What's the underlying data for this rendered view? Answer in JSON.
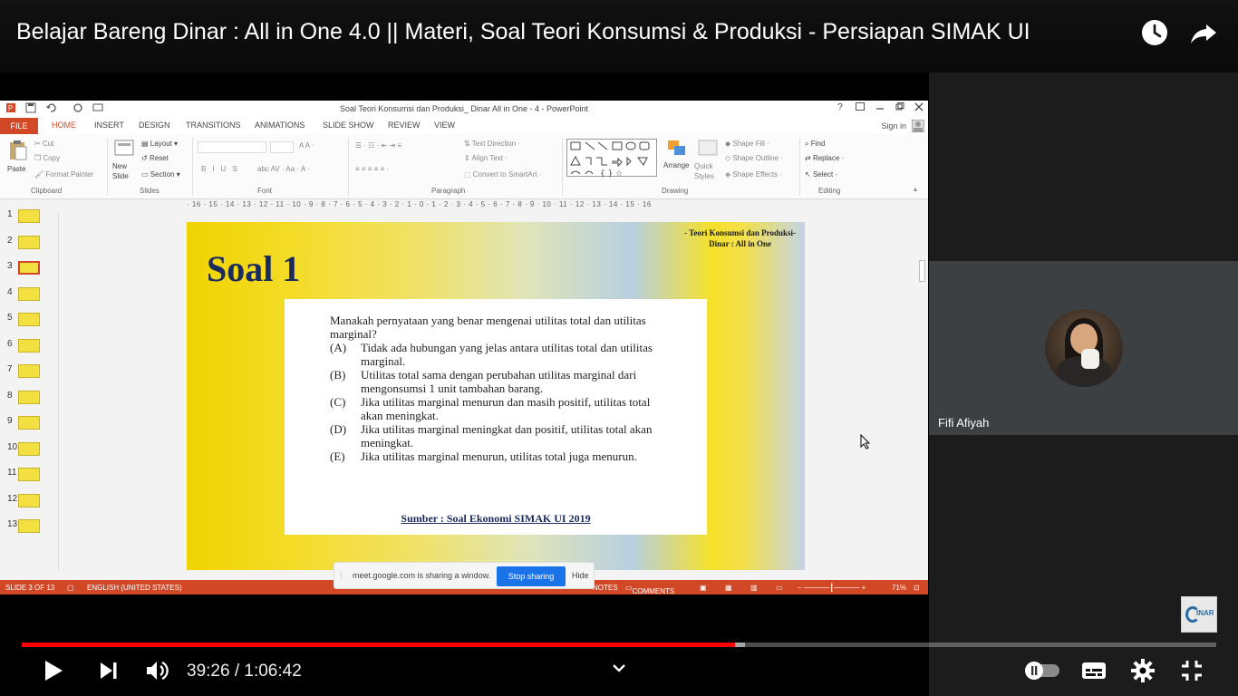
{
  "video": {
    "title": "Belajar Bareng Dinar : All in One 4.0 || Materi, Soal Teori Konsumsi & Produksi - Persiapan SIMAK UI",
    "current_time": "39:26",
    "separator": " / ",
    "duration": "1:06:42",
    "progress": 0.5974,
    "buffered": 0.6052,
    "progress_color": "#ff0000"
  },
  "powerpoint": {
    "window_title": "Soal Teori Konsumsi dan Produksi_ Dinar All in One - 4 - PowerPoint",
    "tabs": [
      "FILE",
      "HOME",
      "INSERT",
      "DESIGN",
      "TRANSITIONS",
      "ANIMATIONS",
      "SLIDE SHOW",
      "REVIEW",
      "VIEW"
    ],
    "active_tab": "HOME",
    "sign_in": "Sign in",
    "ribbon": {
      "clipboard": {
        "label": "Clipboard",
        "paste": "Paste",
        "cut": "Cut",
        "copy": "Copy",
        "format_painter": "Format Painter"
      },
      "slides": {
        "label": "Slides",
        "new_slide": "New Slide",
        "layout": "Layout",
        "reset": "Reset",
        "section": "Section"
      },
      "font": {
        "label": "Font"
      },
      "paragraph": {
        "label": "Paragraph",
        "text_direction": "Text Direction",
        "align_text": "Align Text",
        "convert_smartart": "Convert to SmartArt"
      },
      "drawing": {
        "label": "Drawing",
        "arrange": "Arrange",
        "quick_styles": "Quick Styles",
        "shape_fill": "Shape Fill",
        "shape_outline": "Shape Outline",
        "shape_effects": "Shape Effects"
      },
      "editing": {
        "label": "Editing",
        "find": "Find",
        "replace": "Replace",
        "select": "Select"
      }
    },
    "ruler": "· 16 · 15 · 14 · 13 · 12 · 11 · 10 · 9 · 8 · 7 · 6 · 5 · 4 · 3 · 2 · 1 · 0 · 1 · 2 · 3 · 4 · 5 · 6 · 7 · 8 · 9 · 10 · 11 · 12 · 13 · 14 · 15 · 16",
    "slide_numbers": [
      "1",
      "2",
      "3",
      "4",
      "5",
      "6",
      "7",
      "8",
      "9",
      "10",
      "11",
      "12",
      "13"
    ],
    "selected_slide": 3,
    "status": {
      "slide": "SLIDE 3 OF 13",
      "language": "ENGLISH (UNITED STATES)",
      "notes": "NOTES",
      "comments": "COMMENTS",
      "zoom": "71%"
    }
  },
  "slide": {
    "header_line1": "- Teori Konsumsi dan Produksi-",
    "header_line2": "Dinar : All in One",
    "title": "Soal 1",
    "question": "Manakah pernyataan yang benar mengenai utilitas total dan utilitas marginal?",
    "options": [
      {
        "letter": "(A)",
        "text": "Tidak ada hubungan yang jelas antara utilitas total dan utilitas marginal."
      },
      {
        "letter": "(B)",
        "text": "Utilitas total sama dengan perubahan utilitas marginal dari mengonsumsi 1 unit tambahan barang."
      },
      {
        "letter": "(C)",
        "text": "Jika utilitas marginal menurun dan masih positif, utilitas total akan meningkat."
      },
      {
        "letter": "(D)",
        "text": "Jika utilitas marginal meningkat dan positif, utilitas total akan meningkat."
      },
      {
        "letter": "(E)",
        "text": "Jika utilitas marginal menurun, utilitas total juga menurun."
      }
    ],
    "source": "Sumber : Soal Ekonomi SIMAK UI 2019"
  },
  "meet": {
    "sharing_text": "meet.google.com is sharing a window.",
    "stop_label": "Stop sharing",
    "hide_label": "Hide",
    "participant_name": "Fifi Afiyah",
    "stop_color": "#1a73e8"
  },
  "logo": {
    "text": "INAR"
  },
  "icons": {
    "watch_later": "clock-icon",
    "share": "share-arrow-icon",
    "play": "play-icon",
    "next": "next-icon",
    "volume": "volume-icon",
    "chapters": "chevron-down-icon",
    "autoplay": "autoplay-toggle-icon",
    "captions": "captions-icon",
    "settings": "gear-icon",
    "fullscreen": "exit-fullscreen-icon"
  }
}
